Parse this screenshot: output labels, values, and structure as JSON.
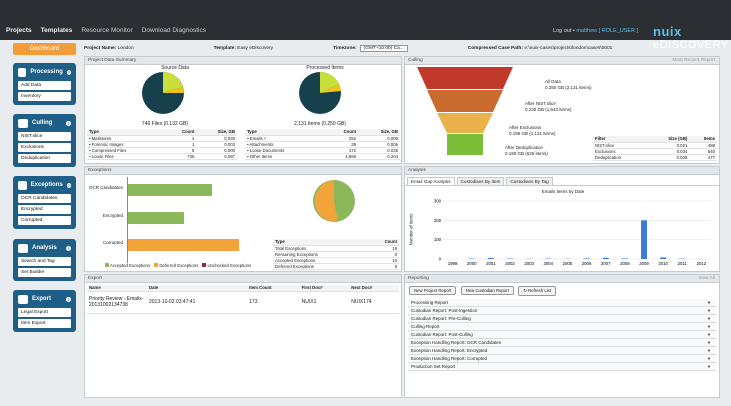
{
  "topbar": {
    "nav": [
      "Projects",
      "Templates",
      "Resource Monitor",
      "Download Diagnostics"
    ],
    "logout": "Log out",
    "user": "matthew",
    "role": "[ ROLE_USER ]",
    "brand_a": "nuix",
    "brand_b": "eDISCOVERY"
  },
  "sidebar": {
    "dashboard": "Dashboard",
    "sections": [
      {
        "title": "Processing",
        "icon": "truck-icon",
        "items": [
          "Add Data",
          "Inventory"
        ]
      },
      {
        "title": "Culling",
        "icon": "funnel-icon",
        "items": [
          "NIST.slice",
          "Exclusions",
          "Deduplication"
        ]
      },
      {
        "title": "Exceptions",
        "icon": "flag-icon",
        "items": [
          "OCR Candidates",
          "Encrypted",
          "Corrupted"
        ]
      },
      {
        "title": "Analysis",
        "icon": "magnifier-icon",
        "items": [
          "Search and Tag",
          "Set Builder"
        ]
      },
      {
        "title": "Export",
        "icon": "export-icon",
        "items": [
          "Legal Export",
          "Item Export"
        ]
      }
    ]
  },
  "header": {
    "project_label": "Project Name:",
    "project": "London",
    "template_label": "Template:",
    "template": "Easy eDiscovery",
    "timezone_label": "Timezone:",
    "timezone": "(GMT+10:00) Ca...",
    "path_label": "Compressed Case Path:",
    "path": "e:\\nuix-cases\\projects\\london\\cases\\0001"
  },
  "summary": {
    "title": "Project Data Summary",
    "pie1_title": "Source Data",
    "pie1_caption": "746 Files (0.132 GB)",
    "pie2_title": "Processed Items",
    "pie2_caption": "2,131 Items (0.250 GB)",
    "left_cols": [
      "Type",
      "Count",
      "Size, GB"
    ],
    "left_rows": [
      [
        "Mailstores",
        "4",
        "0.030"
      ],
      [
        "Forensic Images",
        "1",
        "0.003"
      ],
      [
        "Compressed Files",
        "5",
        "0.000"
      ],
      [
        "Loose Files",
        "736",
        "0.097"
      ]
    ],
    "right_cols": [
      "Type",
      "Count",
      "Size, GB"
    ],
    "right_rows": [
      [
        "Emails +",
        "252",
        "0.005"
      ],
      [
        "Attachments",
        "39",
        "0.006"
      ],
      [
        "Loose Documents",
        "172",
        "0.035"
      ],
      [
        "Other Items",
        "1,668",
        "0.204"
      ]
    ]
  },
  "culling": {
    "title": "Culling",
    "link": "Most Recent Report",
    "labels": [
      {
        "name": "All Data",
        "value": "0.250 GB (2,131 items)"
      },
      {
        "name": "After NIST.slice",
        "value": "0.230 GB (1,643 items)"
      },
      {
        "name": "After Exclusions",
        "value": "0.195 GB (1,131 items)"
      },
      {
        "name": "After Deduplication",
        "value": "0.190 GB (626 items)"
      }
    ],
    "cols": [
      "Filter",
      "Size (GB)",
      "Items"
    ],
    "rows": [
      [
        "NIST.slice",
        "0.021",
        "488"
      ],
      [
        "Exclusions",
        "0.034",
        "540"
      ],
      [
        "Deduplication",
        "0.005",
        "477"
      ]
    ]
  },
  "exceptions": {
    "title": "Exceptions",
    "bars": [
      {
        "name": "OCR Candidates",
        "value": 9,
        "color": "#8ab85b"
      },
      {
        "name": "Encrypted",
        "value": 6,
        "color": "#8ab85b"
      },
      {
        "name": "Corrupted",
        "value": 12,
        "color": "#f2a43a"
      }
    ],
    "legend": [
      "Accepted Exceptions",
      "Deferred Exceptions",
      "Unchecked Exceptions"
    ],
    "legend_colors": [
      "#8ab85b",
      "#f2a43a",
      "#8b2b3c"
    ],
    "table_cols": [
      "Type",
      "Count"
    ],
    "table_rows": [
      [
        "Total Exceptions",
        "19"
      ],
      [
        "Remaining Exceptions",
        "0"
      ],
      [
        "Accepted Exceptions",
        "10"
      ],
      [
        "Deferred Exceptions",
        "9"
      ]
    ]
  },
  "analysis": {
    "title": "Analysis",
    "tabs": [
      "Email Gap Analysis",
      "Custodians By Item",
      "Custodians By Tag"
    ],
    "chart_title": "Emails Items by Date",
    "ylabel": "Number of Items"
  },
  "chart_data": {
    "type": "bar",
    "title": "Emails Items by Date",
    "xlabel": "",
    "ylabel": "Number of Items",
    "categories": [
      "1999",
      "2000",
      "2001",
      "2002",
      "2003",
      "2004",
      "2005",
      "2006",
      "2007",
      "2008",
      "2009",
      "2010",
      "2011",
      "2012"
    ],
    "values": [
      0,
      2,
      5,
      2,
      1,
      2,
      1,
      3,
      6,
      3,
      200,
      8,
      2,
      0
    ],
    "ylim": [
      0,
      300
    ],
    "yticks": [
      0,
      100,
      200,
      300
    ],
    "xticks": [
      "1999",
      "2000",
      "2001",
      "2002",
      "2003",
      "2004",
      "2005",
      "2006",
      "2007",
      "2008",
      "2009",
      "2010",
      "2011",
      "2012"
    ],
    "grid": true,
    "color": "#3a7fd5"
  },
  "export": {
    "title": "Export",
    "cols": [
      "Name",
      "Date",
      "Item Count",
      "First Doc#",
      "Next Doc#"
    ],
    "row": [
      "Priority Review - Emails-20131002134738",
      "2013-10-02 03:47:41",
      "173",
      "NUIX1",
      "NUIX174"
    ]
  },
  "reporting": {
    "title": "Reporting",
    "link": "View All",
    "buttons": [
      "New Project Report",
      "New Custodian Report",
      "Refresh List"
    ],
    "items": [
      "Processing Report",
      "Custodian Report: Post-Ingestion",
      "Custodian Report: Pre-Culling",
      "Culling Report",
      "Custodian Report: Post-Culling",
      "Exception Handling Report: OCR Candidates",
      "Exception Handling Report: Encrypted",
      "Exception Handling Report: Corrupted",
      "Production Set Report"
    ]
  }
}
